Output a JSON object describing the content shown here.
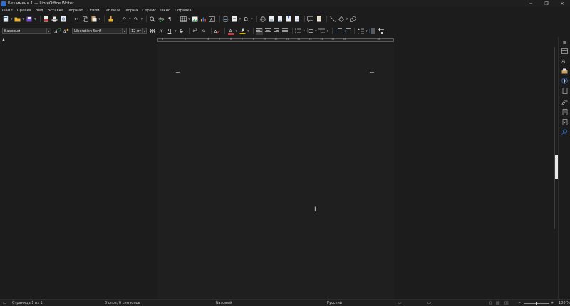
{
  "window": {
    "title": "Без имени 1 — LibreOffice Writer",
    "minimize_glyph": "─",
    "maximize_glyph": "❐",
    "close_glyph": "✕"
  },
  "menu": [
    "Файл",
    "Правка",
    "Вид",
    "Вставка",
    "Формат",
    "Стили",
    "Таблица",
    "Форма",
    "Сервис",
    "Окно",
    "Справка"
  ],
  "formatting": {
    "paragraph_style": "Базовый",
    "font_name": "Liberation Serif",
    "font_size": "12 пт",
    "bold_label": "Ж",
    "italic_label": "К",
    "underline_label": "Ч",
    "strike_label": "S",
    "superscript_label": "x²",
    "subscript_label": "x₂",
    "font_color_label": "A"
  },
  "ruler": {
    "labels": [
      "1",
      "2",
      "4",
      "5",
      "6",
      "7",
      "8",
      "9",
      "10",
      "11",
      "12",
      "13",
      "14",
      "15",
      "16",
      "18"
    ]
  },
  "status": {
    "page": "Страница 1 из 1",
    "words": "0 слов, 0 символов",
    "style": "Базовый",
    "language": "Русский",
    "zoom": "100 %"
  },
  "icons": {
    "new": "new-document-icon",
    "open": "open-folder-icon",
    "save": "save-icon",
    "export_pdf": "export-pdf-icon",
    "print": "print-icon",
    "preview": "print-preview-icon",
    "cut": "cut-icon",
    "copy": "copy-icon",
    "paste": "paste-icon",
    "clone": "clone-formatting-icon",
    "undo": "undo-icon",
    "redo": "redo-icon",
    "find": "find-replace-icon",
    "spelling": "spelling-icon",
    "pilcrow": "formatting-marks-icon"
  },
  "colors": {
    "accent": "#2f6fd1",
    "font_color": "#e03030",
    "highlight": "#f0d020"
  }
}
